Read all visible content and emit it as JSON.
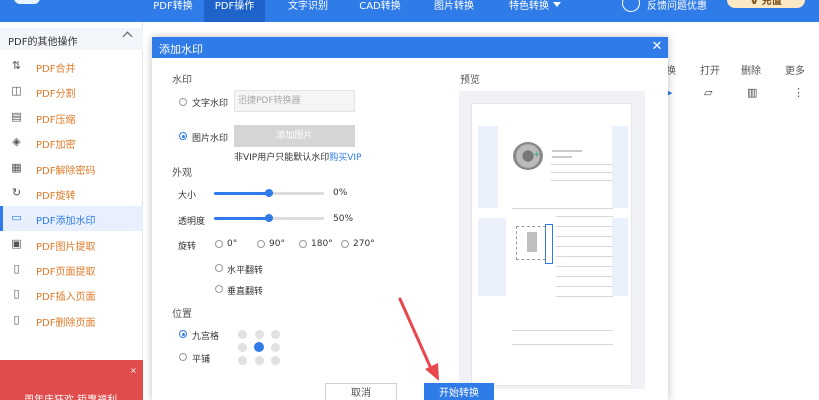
{
  "topnav": {
    "items": [
      {
        "label": "PDF转换"
      },
      {
        "label": "PDF操作"
      },
      {
        "label": "文字识别"
      },
      {
        "label": "CAD转换"
      },
      {
        "label": "图片转换"
      },
      {
        "label": "特色转换"
      }
    ],
    "help_label": "反馈问题优惠",
    "vip_label": "V 充值"
  },
  "sidebar": {
    "header": "PDF的其他操作",
    "items": [
      {
        "label": "PDF合并",
        "icon": "merge-icon"
      },
      {
        "label": "PDF分割",
        "icon": "split-icon"
      },
      {
        "label": "PDF压缩",
        "icon": "compress-icon"
      },
      {
        "label": "PDF加密",
        "icon": "lock-icon"
      },
      {
        "label": "PDF解除密码",
        "icon": "unlock-icon"
      },
      {
        "label": "PDF旋转",
        "icon": "rotate-icon"
      },
      {
        "label": "PDF添加水印",
        "icon": "watermark-icon"
      },
      {
        "label": "PDF图片提取",
        "icon": "image-extract-icon"
      },
      {
        "label": "PDF页面提取",
        "icon": "page-extract-icon"
      },
      {
        "label": "PDF插入页面",
        "icon": "page-insert-icon"
      },
      {
        "label": "PDF删除页面",
        "icon": "page-delete-icon"
      }
    ],
    "active_index": 6,
    "promo_text": "周年庆狂欢 钜惠福利"
  },
  "toolbar": {
    "labels": [
      "换",
      "打开",
      "删除",
      "更多"
    ]
  },
  "dialog": {
    "title": "添加水印",
    "watermark_section": "水印",
    "text_watermark_label": "文字水印",
    "text_watermark_placeholder": "迅捷PDF转换器",
    "image_watermark_label": "图片水印",
    "add_image_label": "添加图片",
    "vip_note": "非VIP用户只能默认水印",
    "vip_link": "购买VIP",
    "appearance_section": "外观",
    "size_label": "大小",
    "size_value": "0%",
    "size_level": 0.5,
    "opacity_label": "透明度",
    "opacity_value": "50%",
    "opacity_level": 0.5,
    "rotate_label": "旋转",
    "rotate_options": [
      "0°",
      "90°",
      "180°",
      "270°"
    ],
    "flip_h_label": "水平翻转",
    "flip_v_label": "垂直翻转",
    "position_section": "位置",
    "grid_label": "九宫格",
    "tile_label": "平铺",
    "preview_label": "预览",
    "cancel_label": "取消",
    "start_label": "开始转换"
  },
  "colors": {
    "primary": "#2f7be8",
    "sidebar_text": "#e07b2a",
    "promo": "#e04b4b"
  }
}
